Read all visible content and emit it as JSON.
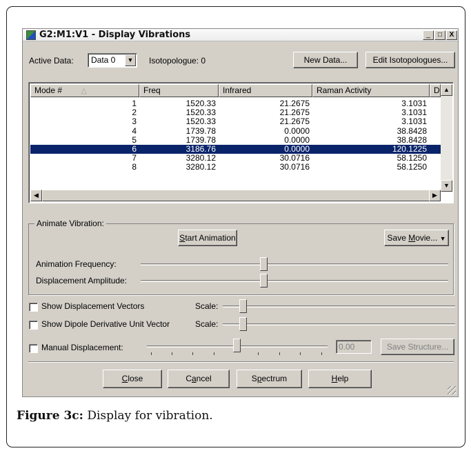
{
  "window": {
    "title": "G2:M1:V1 - Display Vibrations",
    "minimize": "_",
    "maximize": "□",
    "close": "X"
  },
  "top": {
    "active_data_label": "Active Data:",
    "active_data_value": "Data 0",
    "isotopologue_label": "Isotopologue: 0",
    "new_data_button": "New Data...",
    "edit_isotopologues_button": "Edit Isotopologues..."
  },
  "table": {
    "columns": [
      "Mode #",
      "Freq",
      "Infrared",
      "Raman Activity",
      "D"
    ],
    "rows": [
      {
        "mode": "1",
        "freq": "1520.33",
        "infrared": "21.2675",
        "raman": "3.1031"
      },
      {
        "mode": "2",
        "freq": "1520.33",
        "infrared": "21.2675",
        "raman": "3.1031"
      },
      {
        "mode": "3",
        "freq": "1520.33",
        "infrared": "21.2675",
        "raman": "3.1031"
      },
      {
        "mode": "4",
        "freq": "1739.78",
        "infrared": "0.0000",
        "raman": "38.8428"
      },
      {
        "mode": "5",
        "freq": "1739.78",
        "infrared": "0.0000",
        "raman": "38.8428"
      },
      {
        "mode": "6",
        "freq": "3186.76",
        "infrared": "0.0000",
        "raman": "120.1225"
      },
      {
        "mode": "7",
        "freq": "3280.12",
        "infrared": "30.0716",
        "raman": "58.1250"
      },
      {
        "mode": "8",
        "freq": "3280.12",
        "infrared": "30.0716",
        "raman": "58.1250"
      }
    ],
    "selected_row_index": 5
  },
  "animate": {
    "group_label": "Animate Vibration:",
    "start_pre": "",
    "start_key": "S",
    "start_post": "tart Animation",
    "save_pre": "Save ",
    "save_key": "M",
    "save_post": "ovie...",
    "frequency_label": "Animation Frequency:",
    "amplitude_label": "Displacement Amplitude:",
    "frequency_level": 0.5,
    "amplitude_level": 0.5
  },
  "options": {
    "show_displacement_vectors": "Show Displacement Vectors",
    "show_dipole_derivative": "Show Dipole Derivative Unit Vector",
    "scale_label": "Scale:",
    "manual_displacement": "Manual Displacement:",
    "manual_value": "0.00",
    "save_structure": "Save Structure..."
  },
  "bottom": {
    "close_pre": "",
    "close_key": "C",
    "close_post": "lose",
    "cancel_pre": "C",
    "cancel_key": "a",
    "cancel_post": "ncel",
    "spectrum_pre": "S",
    "spectrum_key": "p",
    "spectrum_post": "ectrum",
    "help_pre": "",
    "help_key": "H",
    "help_post": "elp"
  },
  "caption": {
    "label": "Figure 3c:",
    "text": " Display for vibration."
  }
}
